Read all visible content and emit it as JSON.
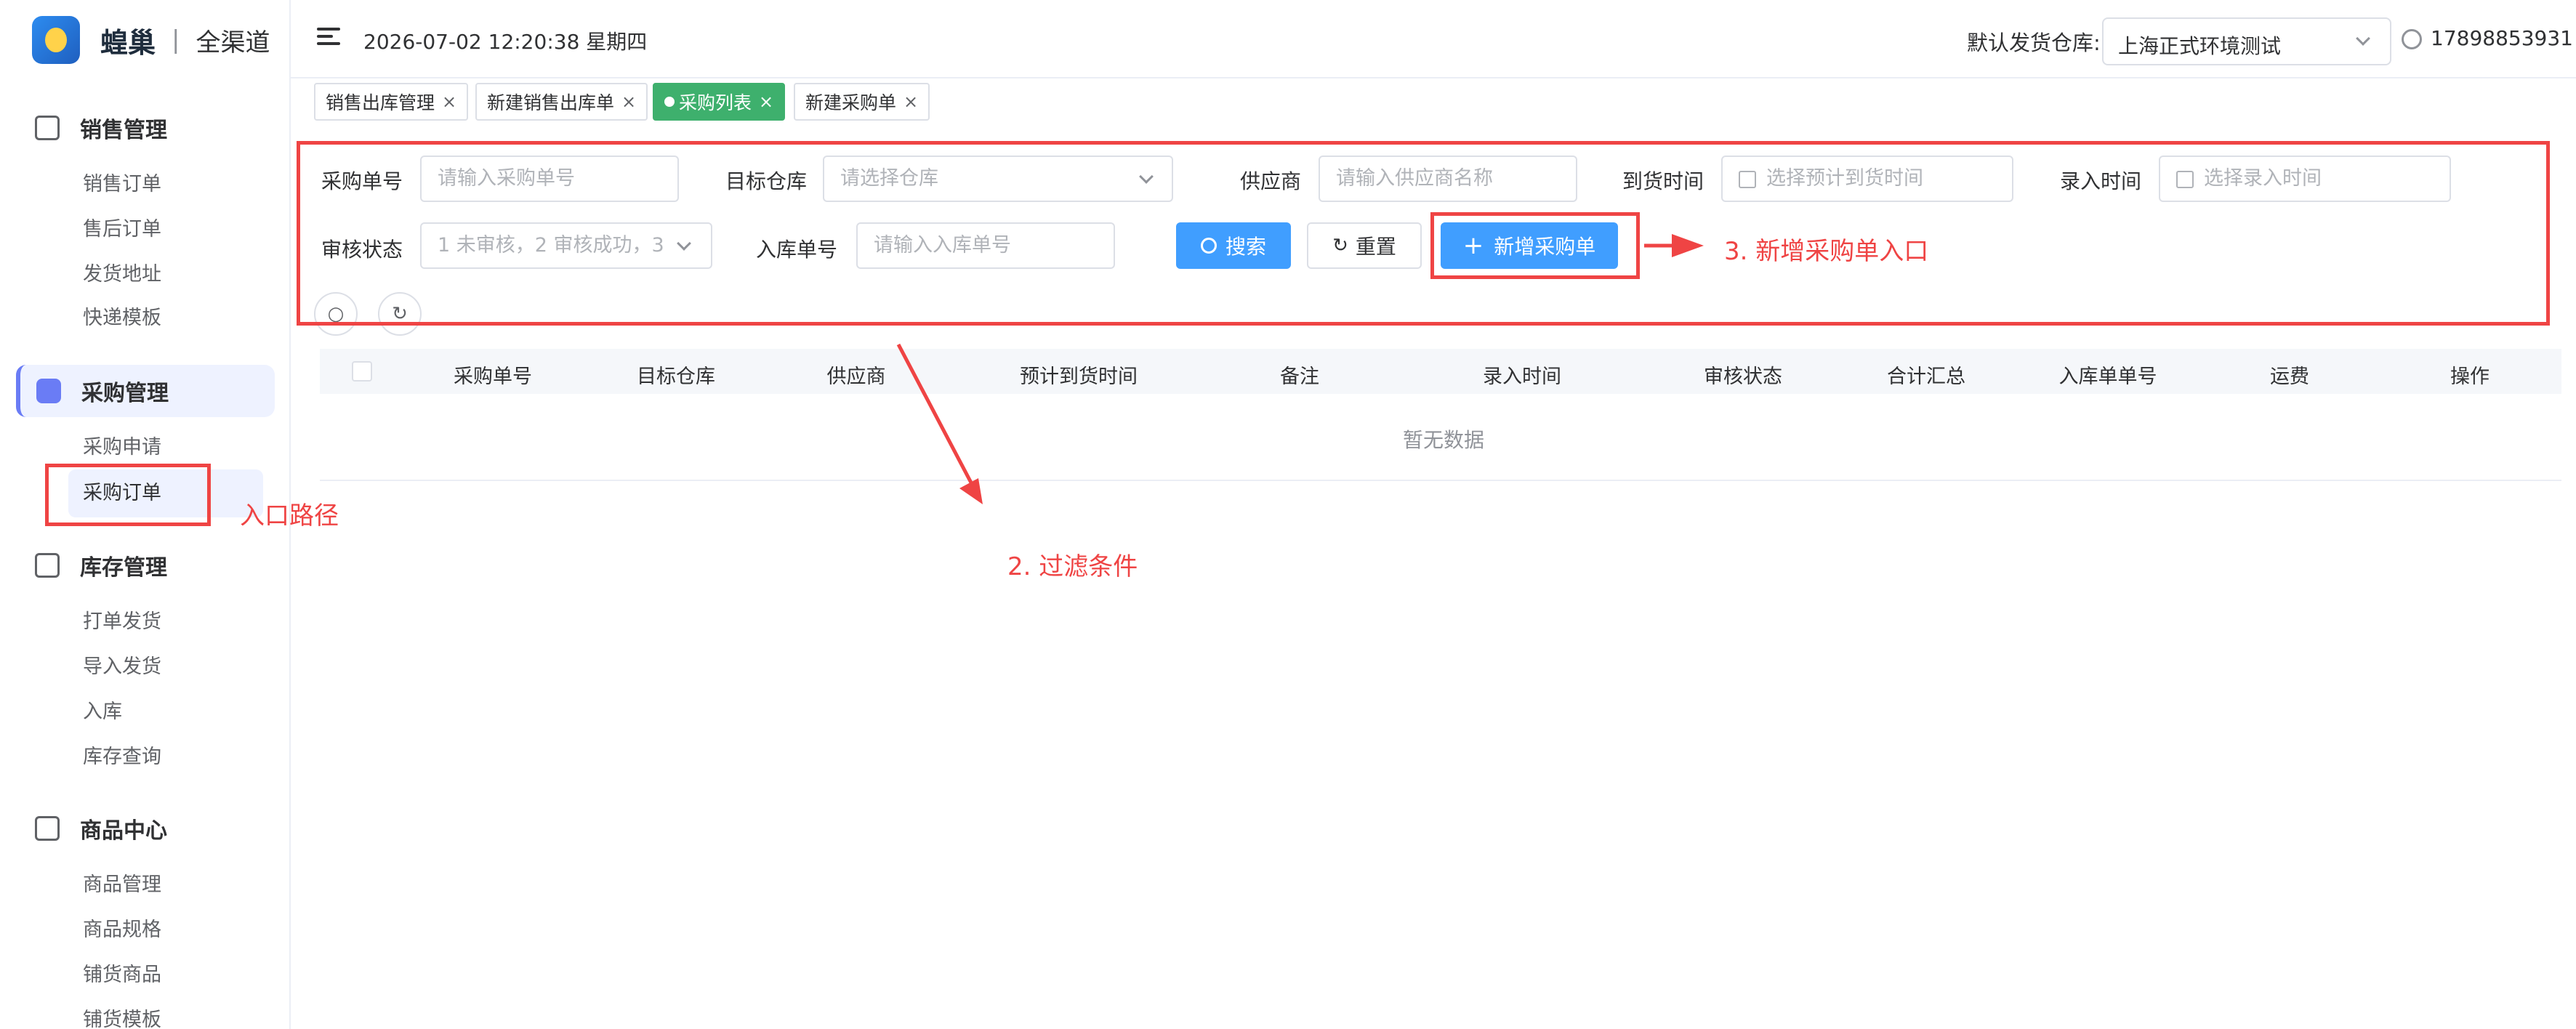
{
  "app": {
    "logo_name": "蝗巢",
    "logo_sub": "全渠道"
  },
  "sidebar": {
    "groups": [
      {
        "label": "销售管理",
        "items": [
          "销售订单",
          "售后订单",
          "发货地址",
          "快递模板"
        ]
      },
      {
        "label": "采购管理",
        "items": [
          "采购申请",
          "采购订单"
        ]
      },
      {
        "label": "库存管理",
        "items": [
          "打单发货",
          "导入发货",
          "入库",
          "库存查询"
        ]
      },
      {
        "label": "商品中心",
        "items": [
          "商品管理",
          "商品规格",
          "铺货商品",
          "铺货模板"
        ]
      }
    ]
  },
  "header": {
    "datetime": "2026-07-02 12:20:38 星期四",
    "warehouse_label": "默认发货仓库:",
    "warehouse_value": "上海正式环境测试",
    "user": "17898853931"
  },
  "tabs": [
    {
      "label": "销售出库管理"
    },
    {
      "label": "新建销售出库单"
    },
    {
      "label": "采购列表"
    },
    {
      "label": "新建采购单"
    }
  ],
  "filters": {
    "purchase_no_label": "采购单号",
    "purchase_no_placeholder": "请输入采购单号",
    "warehouse_label": "目标仓库",
    "warehouse_placeholder": "请选择仓库",
    "supplier_label": "供应商",
    "supplier_placeholder": "请输入供应商名称",
    "arrival_label": "到货时间",
    "arrival_placeholder": "选择预计到货时间",
    "entry_label": "录入时间",
    "entry_placeholder": "选择录入时间",
    "audit_label": "审核状态",
    "audit_placeholder": "1 未审核，2 审核成功，3",
    "stockin_label": "入库单号",
    "stockin_placeholder": "请输入入库单号",
    "search_btn": "搜索",
    "reset_btn": "重置",
    "add_btn": "新增采购单"
  },
  "table": {
    "columns": [
      "采购单号",
      "目标仓库",
      "供应商",
      "预计到货时间",
      "备注",
      "录入时间",
      "审核状态",
      "合计汇总",
      "入库单单号",
      "运费",
      "操作"
    ],
    "empty_text": "暂无数据"
  },
  "annotations": {
    "entry_path": "入口路径",
    "filter_conditions": "2. 过滤条件",
    "new_entry": "3. 新增采购单入口"
  },
  "colors": {
    "accent": "#409eff",
    "active_tab": "#3eb06d",
    "annotation": "#ef4444",
    "menu_active": "#6a7cf5"
  }
}
